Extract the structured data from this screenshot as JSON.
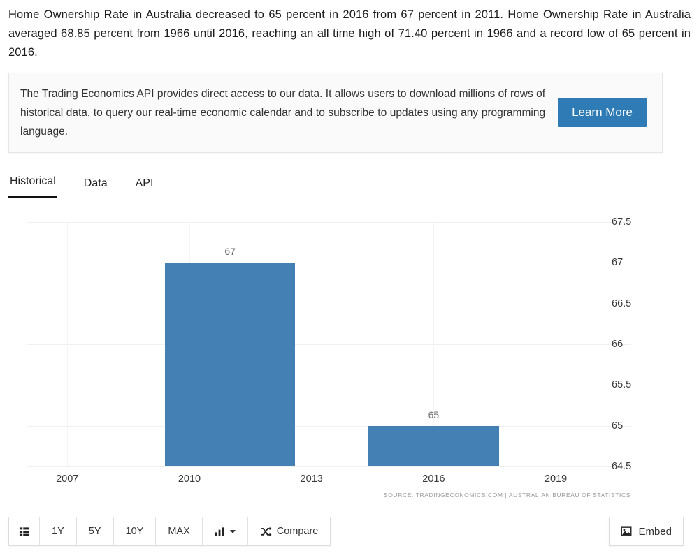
{
  "intro": {
    "paragraph": "Home Ownership Rate in Australia decreased to 65 percent in 2016 from 67 percent in 2011. Home Ownership Rate in Australia averaged 68.85 percent from 1966 until 2016, reaching an all time high of 71.40 percent in 1966 and a record low of 65 percent in 2016."
  },
  "api_banner": {
    "text": "The Trading Economics API provides direct access to our data. It allows users to download millions of rows of historical data, to query our real-time economic calendar and to subscribe to updates using any programming language.",
    "button_label": "Learn More",
    "button_color": "#2e7bb5"
  },
  "tabs": [
    {
      "label": "Historical",
      "active": true
    },
    {
      "label": "Data",
      "active": false
    },
    {
      "label": "API",
      "active": false
    }
  ],
  "chart_data": {
    "type": "bar",
    "title": "",
    "subtitle": "",
    "xlabel": "",
    "ylabel": "",
    "categories": [
      "2011",
      "2016"
    ],
    "values": [
      67,
      65
    ],
    "data_labels": [
      "67",
      "65"
    ],
    "series": [
      {
        "name": "Home Ownership Rate in Australia",
        "values": [
          67,
          65
        ]
      }
    ],
    "ylim": [
      64.5,
      67.5
    ],
    "ytick_labels": [
      "67.5",
      "67",
      "66.5",
      "66",
      "65.5",
      "65",
      "64.5"
    ],
    "ytick_values": [
      67.5,
      67,
      66.5,
      66,
      65.5,
      65,
      64.5
    ],
    "xtick_labels": [
      "2007",
      "2010",
      "2013",
      "2016",
      "2019"
    ],
    "xlim": [
      2006,
      2020.2
    ],
    "grid": true,
    "legend": false,
    "bar_color": "#4480b4",
    "source": "SOURCE: TRADINGECONOMICS.COM | AUSTRALIAN BUREAU OF STATISTICS"
  },
  "toolbar": {
    "menu_icon": "stacked-list-icon",
    "ranges": [
      "1Y",
      "5Y",
      "10Y",
      "MAX"
    ],
    "charttype_icon": "bar-chart-icon",
    "compare_icon": "shuffle-icon",
    "compare_label": "Compare",
    "embed_icon": "image-icon",
    "embed_label": "Embed"
  }
}
